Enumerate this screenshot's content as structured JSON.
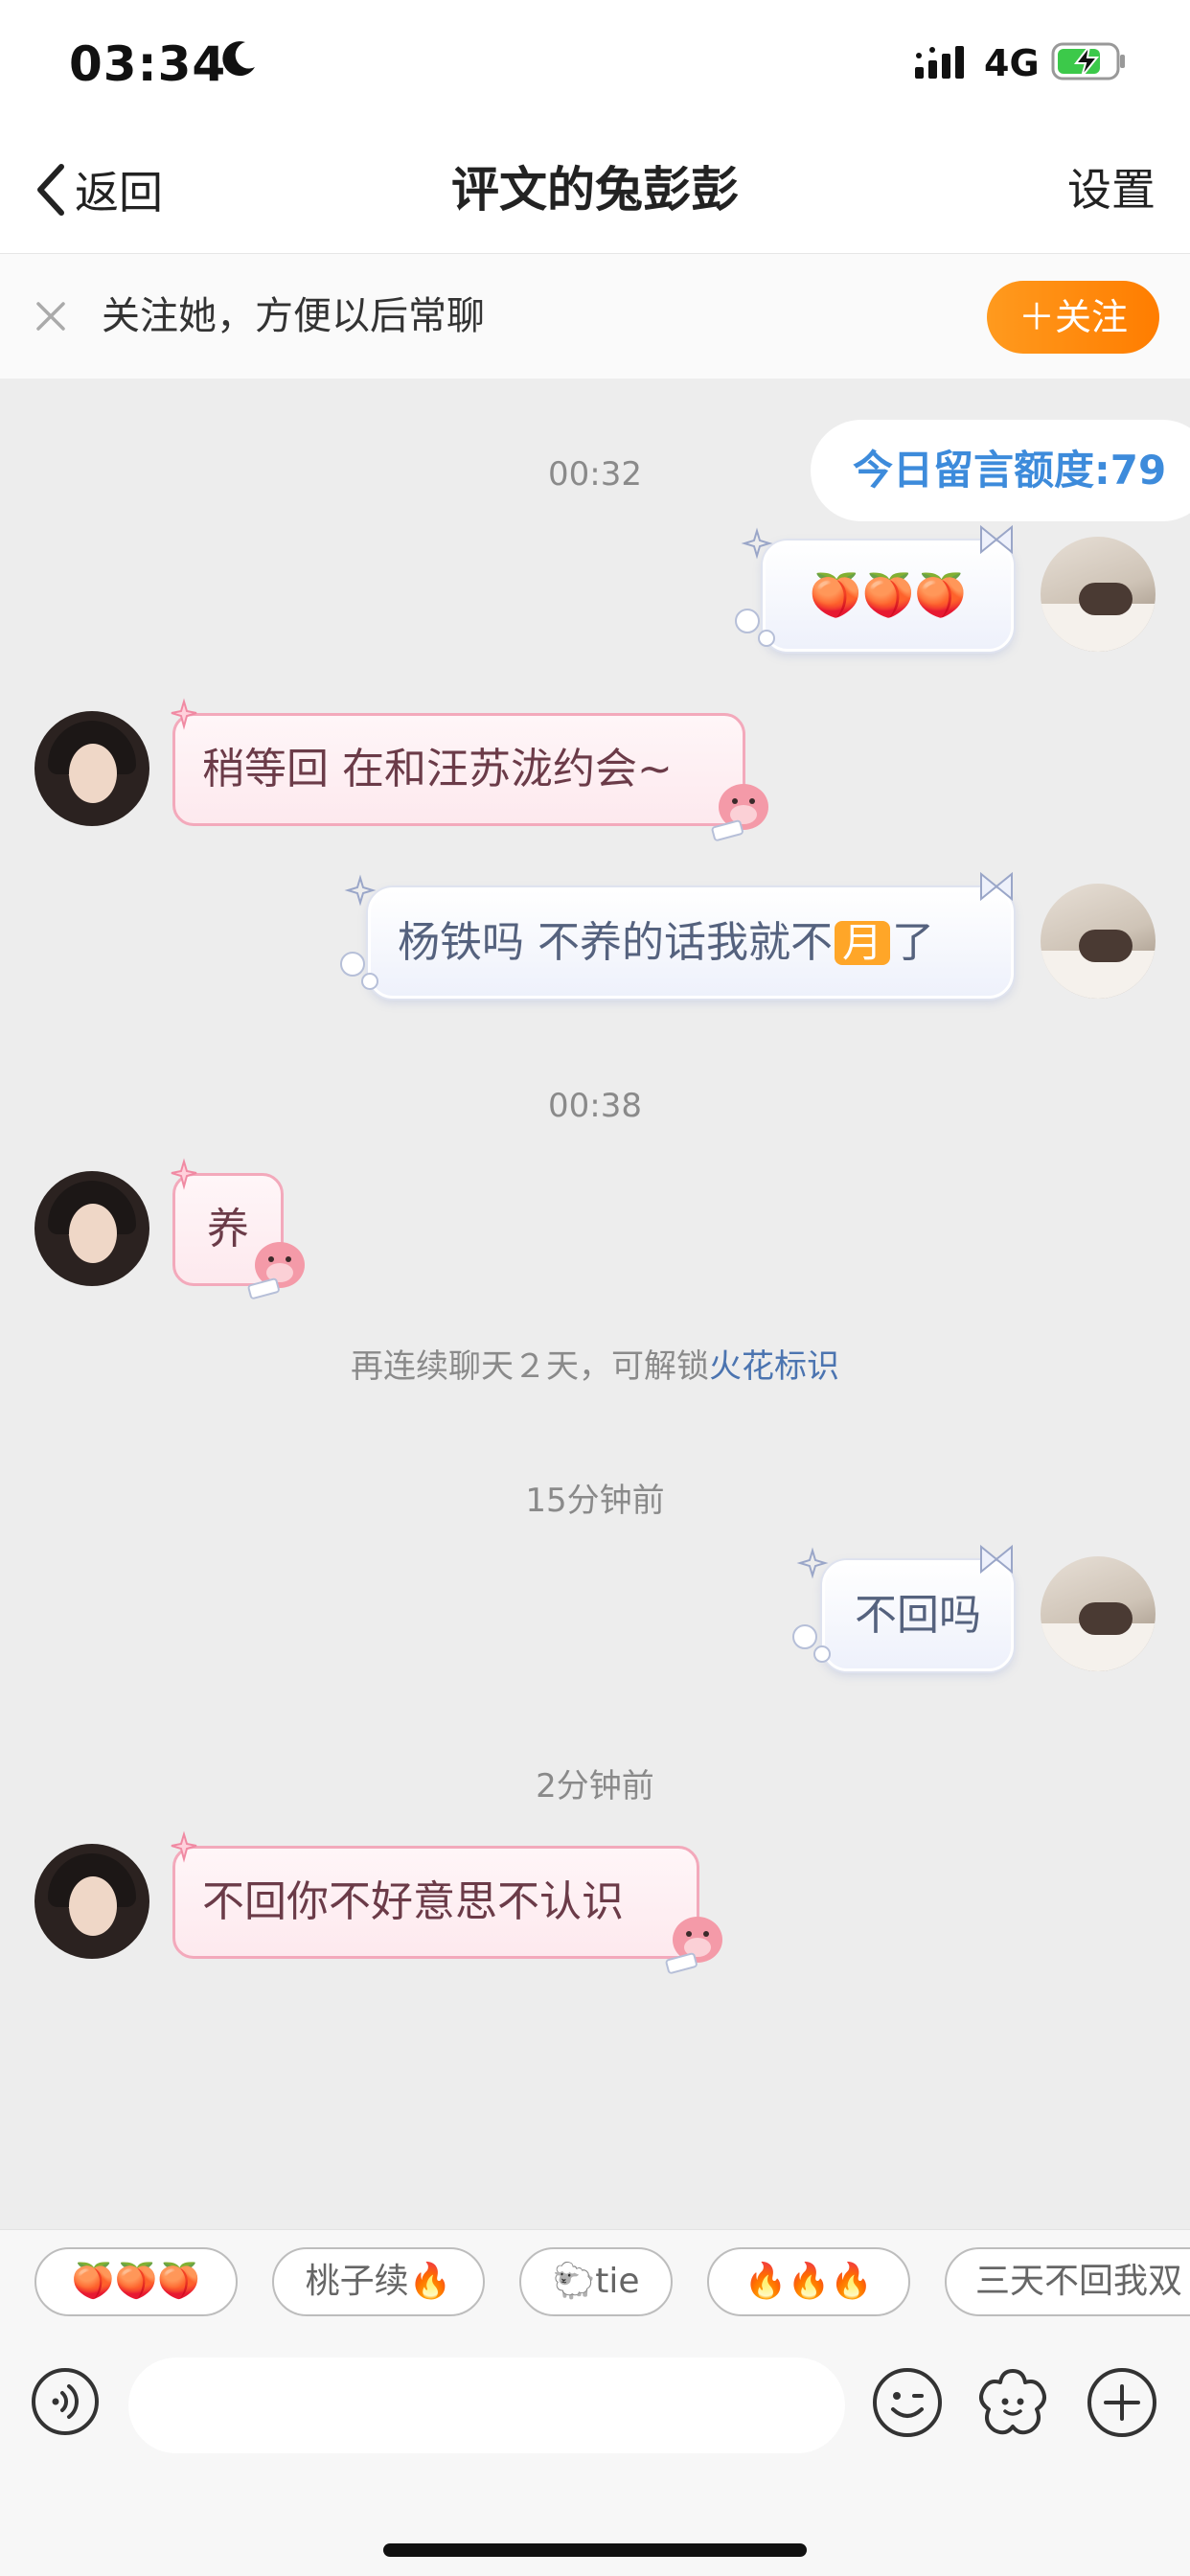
{
  "status_bar": {
    "time": "03:34",
    "network": "4G",
    "icons": [
      "moon-icon",
      "signal-icon",
      "battery-charging-icon"
    ]
  },
  "nav": {
    "back_label": "返回",
    "title": "评文的兔彭彭",
    "settings_label": "设置"
  },
  "follow_bar": {
    "prompt": "关注她，方便以后常聊",
    "button_label": "＋关注"
  },
  "quota": {
    "label": "今日留言额度:79"
  },
  "timestamps": [
    "00:32",
    "00:38",
    "15分钟前",
    "2分钟前"
  ],
  "messages": [
    {
      "side": "right",
      "text": "🍑🍑🍑"
    },
    {
      "side": "left",
      "text": "稍等回 在和汪苏泷约会~"
    },
    {
      "side": "right",
      "text_before": "杨铁吗 不养的话我就不",
      "boxed": "月",
      "text_after": "了"
    },
    {
      "side": "left",
      "text": "养"
    },
    {
      "side": "right",
      "text": "不回吗"
    },
    {
      "side": "left",
      "text": "不回你不好意思不认识"
    }
  ],
  "system_notice": {
    "text": "再连续聊天２天，可解锁",
    "highlight": "火花标识"
  },
  "quick_replies": [
    "🍑🍑🍑",
    "桃子续🔥",
    "🐑tie",
    "🔥🔥🔥",
    "三天不回我双"
  ],
  "input": {
    "placeholder": ""
  },
  "colors": {
    "accent_orange": "#ff8a0f",
    "quota_blue": "#3d8bdb",
    "left_bubble_border": "#f3a9bb",
    "background": "#ededed"
  }
}
